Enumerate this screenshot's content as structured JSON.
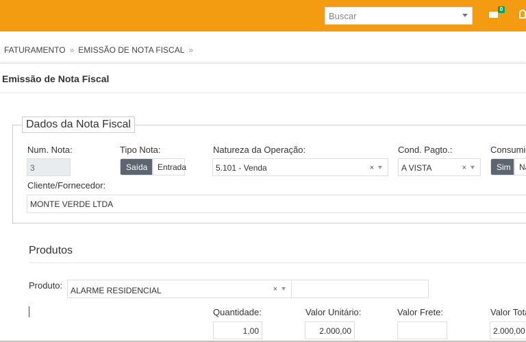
{
  "header": {
    "search_placeholder": "Buscar",
    "mail_count": "0",
    "accent": "#f39c12"
  },
  "breadcrumb": [
    "FATURAMENTO",
    "EMISSÃO DE NOTA FISCAL"
  ],
  "page_title": "Emissão de Nota Fiscal",
  "section": {
    "legend": "Dados da Nota Fiscal",
    "num_nota_label": "Num. Nota:",
    "num_nota_value": "3",
    "tipo_nota_label": "Tipo Nota:",
    "tipo_saida": "Saída",
    "tipo_entrada": "Entrada",
    "natureza_label": "Natureza da Operação:",
    "natureza_value": "5.101 - Venda",
    "cond_label": "Cond. Pagto.:",
    "cond_value": "A VISTA",
    "consumidor_label": "Consumidor",
    "consumidor_sim": "Sim",
    "consumidor_nao": "Não",
    "cliente_label": "Cliente/Fornecedor:",
    "cliente_value": "MONTE VERDE LTDA"
  },
  "produtos": {
    "heading": "Produtos",
    "produto_label": "Produto:",
    "produto_value": "ALARME RESIDENCIAL",
    "quantidade_label": "Quantidade:",
    "quantidade_value": "1,00",
    "valor_unitario_label": "Valor Unitário:",
    "valor_unitario_value": "2.000,00",
    "valor_frete_label": "Valor Frete:",
    "valor_frete_value": "",
    "valor_total_label": "Valor Total:",
    "valor_total_value": "2.000,00"
  }
}
